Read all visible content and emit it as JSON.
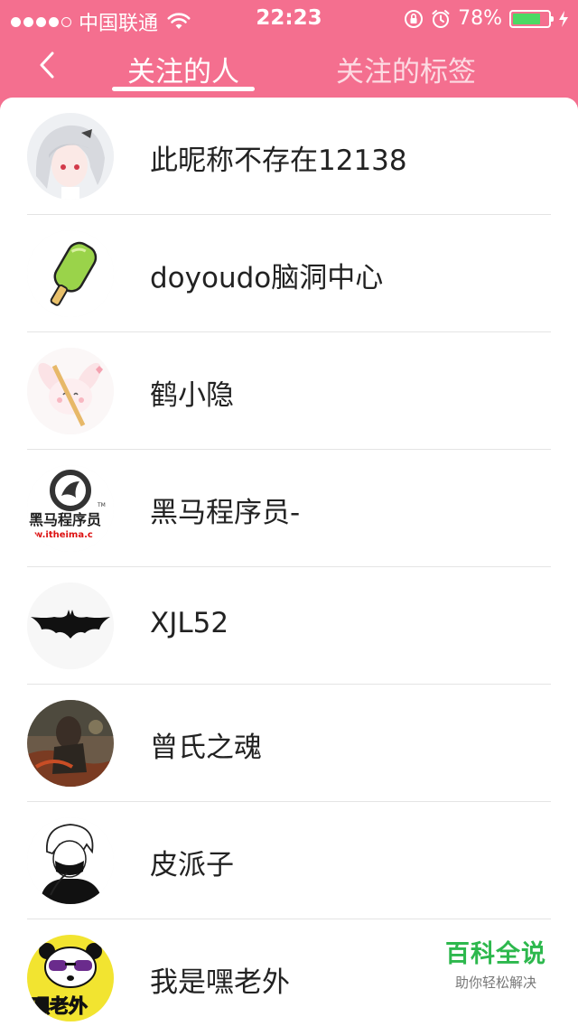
{
  "status_bar": {
    "carrier": "中国联通",
    "time": "22:23",
    "battery_percent": "78%",
    "battery_level": 0.78,
    "signal_icon": "signal-dots-icon",
    "wifi_icon": "wifi-icon",
    "lock_icon": "orientation-lock-icon",
    "alarm_icon": "alarm-icon",
    "charging_icon": "charging-bolt-icon"
  },
  "nav": {
    "back_icon": "chevron-left-icon",
    "tabs": [
      {
        "label": "关注的人",
        "active": true
      },
      {
        "label": "关注的标签",
        "active": false
      }
    ]
  },
  "following": [
    {
      "name": "此昵称不存在12138"
    },
    {
      "name": "doyoudo脑洞中心"
    },
    {
      "name": "鹤小隐"
    },
    {
      "name": "黑马程序员-"
    },
    {
      "name": "XJL52"
    },
    {
      "name": "曾氏之魂"
    },
    {
      "name": "皮派子"
    },
    {
      "name": "我是嘿老外"
    }
  ],
  "avatar_texts": {
    "heima_top": "黑马程序员",
    "heima_url": "w.itheima.c",
    "heima_tm": "TM",
    "laowai": "嘿老外"
  },
  "watermark": {
    "title": "百科全说",
    "subtitle": "助你轻松解决"
  },
  "colors": {
    "header_pink": "#f46f8f",
    "battery_green": "#4cd964",
    "watermark_green": "#2db84d"
  }
}
